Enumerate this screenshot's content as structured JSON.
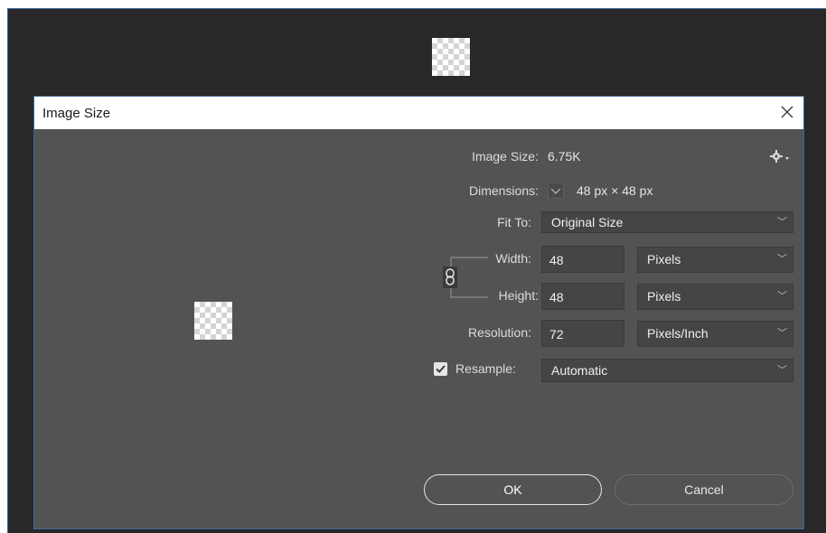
{
  "dialog": {
    "title": "Image Size"
  },
  "info": {
    "image_size_label": "Image Size:",
    "image_size_value": "6.75K",
    "dimensions_label": "Dimensions:",
    "dimensions_value": "48 px  ×  48 px"
  },
  "fit_to": {
    "label": "Fit To:",
    "value": "Original Size"
  },
  "width": {
    "label": "Width:",
    "value": "48",
    "unit": "Pixels"
  },
  "height": {
    "label": "Height:",
    "value": "48",
    "unit": "Pixels"
  },
  "resolution": {
    "label": "Resolution:",
    "value": "72",
    "unit": "Pixels/Inch"
  },
  "resample": {
    "label": "Resample:",
    "checked": true,
    "value": "Automatic"
  },
  "buttons": {
    "ok": "OK",
    "cancel": "Cancel"
  },
  "icons": {
    "close": "close-icon",
    "settings": "gear-icon",
    "link": "chain-link-icon",
    "checkbox": "checkmark-icon",
    "chevron": "chevron-down-icon"
  },
  "colors": {
    "dialog_bg": "#535353",
    "field_bg": "#454545",
    "accent_border": "#3d6a96"
  }
}
